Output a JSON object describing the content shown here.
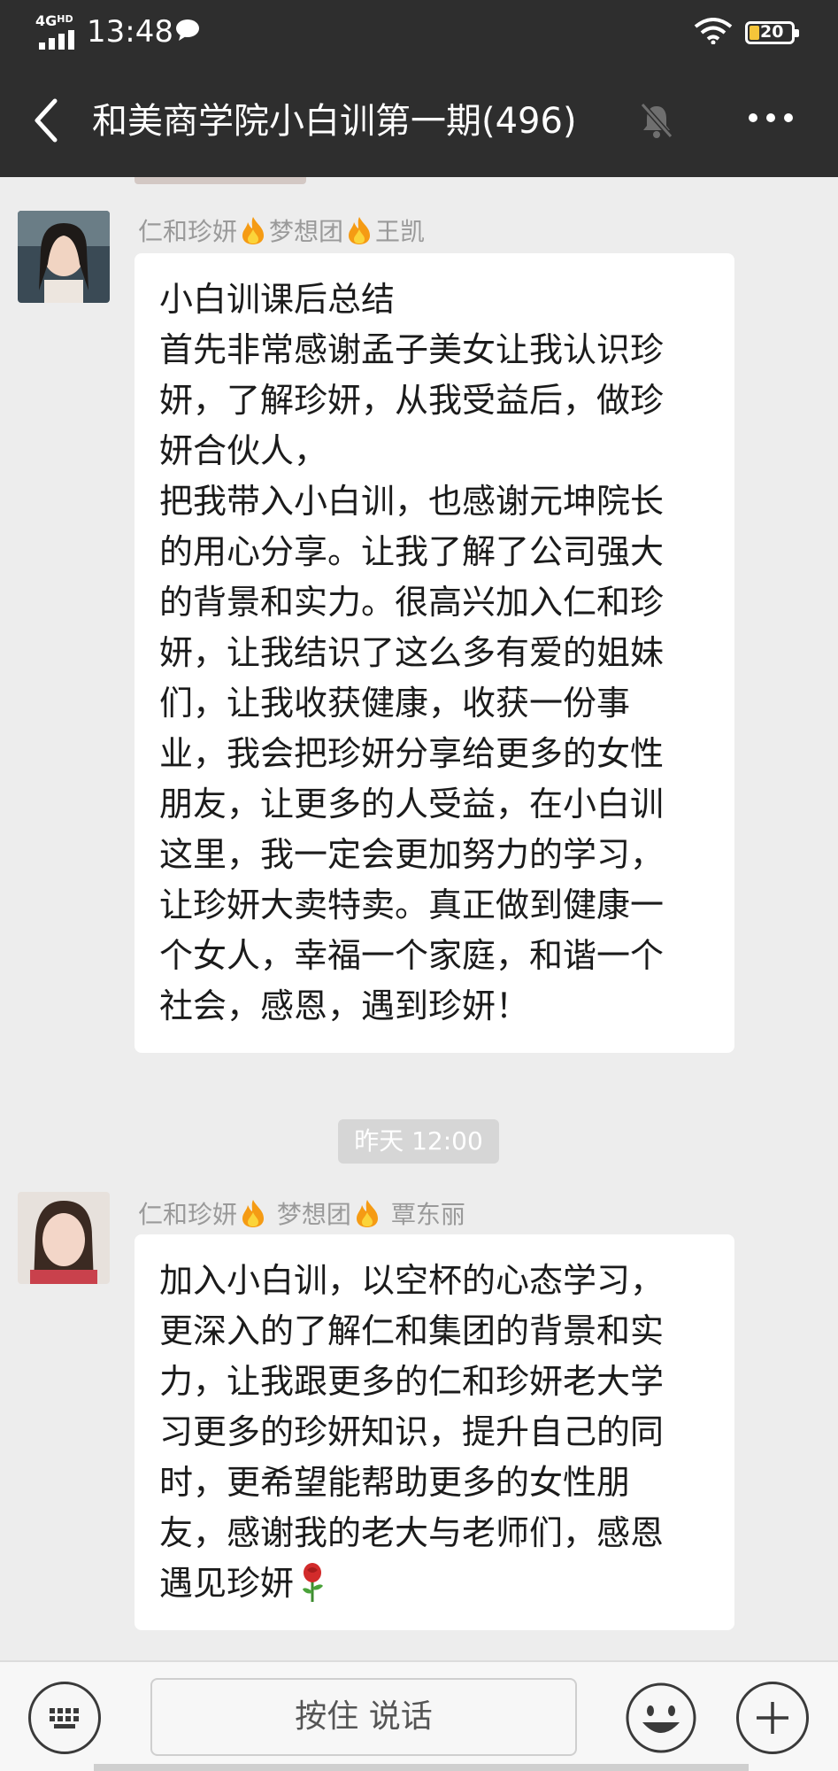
{
  "status_bar": {
    "network": "4G",
    "network_sub": "HD",
    "time": "13:48",
    "battery": "20"
  },
  "nav": {
    "title": "和美商学院小白训第一期(496)"
  },
  "messages": [
    {
      "sender_parts": [
        "仁和珍妍",
        "梦想团",
        "王凯"
      ],
      "lines": [
        "小白训课后总结",
        "首先非常感谢孟子美女让我认识珍",
        "妍，了解珍妍，从我受益后，做珍",
        "妍合伙人，",
        "把我带入小白训，也感谢元坤院长",
        "的用心分享。让我了解了公司强大",
        "的背景和实力。很高兴加入仁和珍",
        "妍，让我结识了这么多有爱的姐妹",
        "们，让我收获健康，收获一份事",
        "业，我会把珍妍分享给更多的女性",
        "朋友，让更多的人受益，在小白训",
        "这里，我一定会更加努力的学习，",
        "让珍妍大卖特卖。真正做到健康一",
        "个女人，幸福一个家庭，和谐一个",
        "社会，感恩，遇到珍妍！"
      ]
    },
    {
      "sender_parts": [
        "仁和珍妍",
        "梦想团",
        "覃东丽"
      ],
      "lines": [
        "加入小白训，以空杯的心态学习，",
        "更深入的了解仁和集团的背景和实",
        "力，让我跟更多的仁和珍妍老大学",
        "习更多的珍妍知识，提升自己的同",
        "时，更希望能帮助更多的女性朋",
        "友，感谢我的老大与老师们，感恩",
        "遇见珍妍"
      ]
    }
  ],
  "timestamp": "昨天 12:00",
  "input_bar": {
    "voice_label": "按住 说话"
  },
  "icons": {
    "back": "back-arrow-icon",
    "mute": "mute-bell-icon",
    "more": "more-dots-icon",
    "flame": "flame-emoji-icon",
    "rose": "rose-emoji-icon",
    "keyboard": "keyboard-icon",
    "emoji": "emoji-face-icon",
    "plus": "plus-icon"
  },
  "colors": {
    "header_bg": "#2e2e2e",
    "chat_bg": "#ededed",
    "bubble_bg": "#ffffff",
    "sender_text": "#9a9a9a",
    "battery_fill": "#f5c53a"
  }
}
